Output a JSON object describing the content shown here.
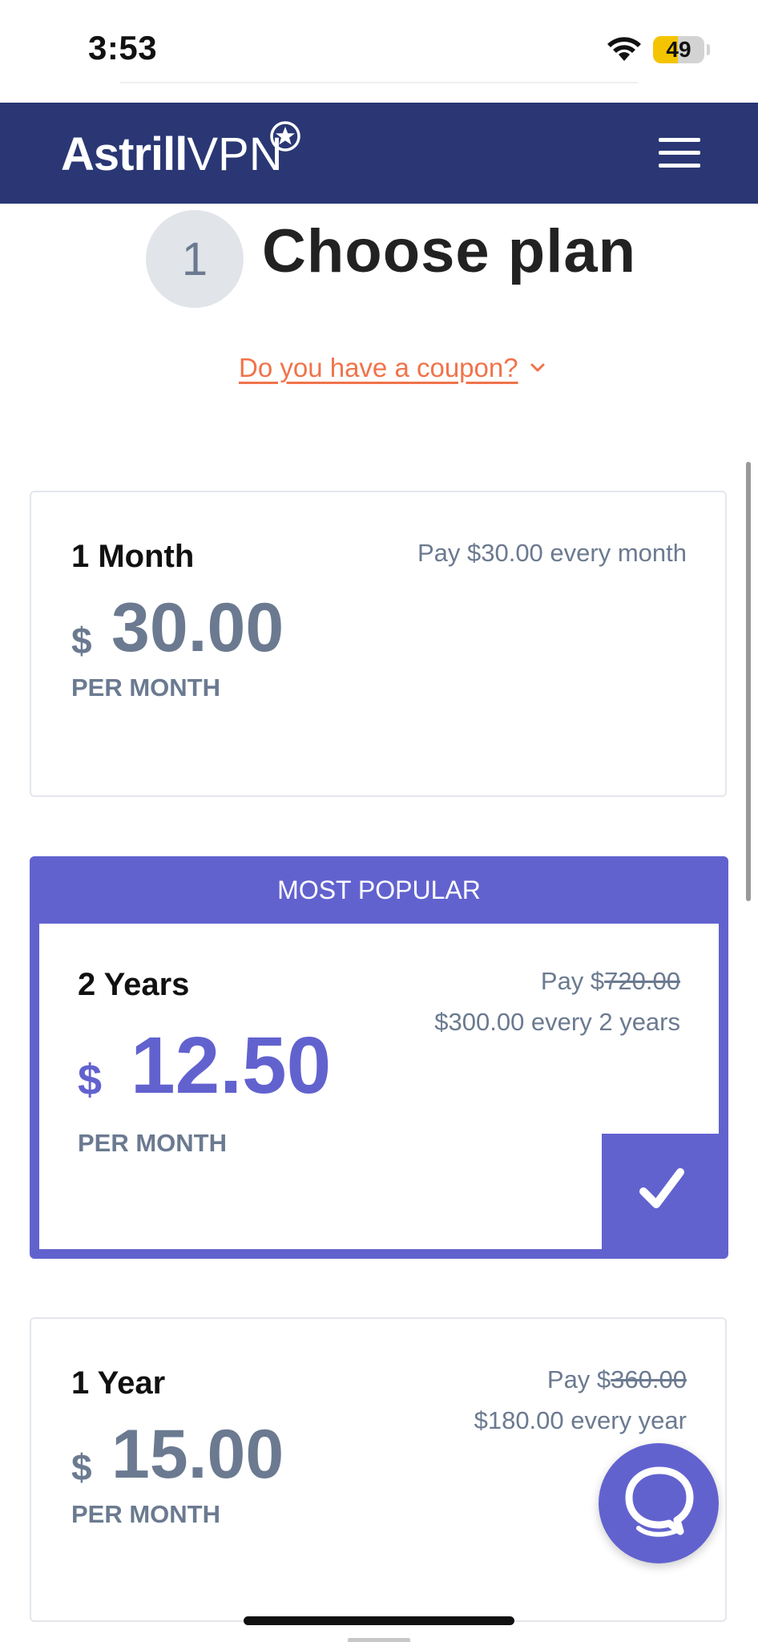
{
  "status_bar": {
    "time": "3:53",
    "battery": "49",
    "battery_level": 0.49
  },
  "header": {
    "logo_bold": "Astrill",
    "logo_light": "VPN"
  },
  "step": {
    "number": "1",
    "title": "Choose plan"
  },
  "coupon": {
    "label": "Do you have a coupon?"
  },
  "plans": [
    {
      "name": "1 Month",
      "currency": "$",
      "price": "30.00",
      "period": "PER MONTH",
      "pay_line": "Pay $30.00 every month"
    },
    {
      "badge": "MOST POPULAR",
      "name": "2 Years",
      "currency": "$",
      "price": "12.50",
      "period": "PER MONTH",
      "pay_prefix": "Pay $",
      "pay_original": "720.00",
      "pay_total": "$300.00 every 2 years",
      "selected": true
    },
    {
      "name": "1 Year",
      "currency": "$",
      "price": "15.00",
      "period": "PER MONTH",
      "pay_prefix": "Pay $",
      "pay_original": "360.00",
      "pay_total": "$180.00 every year"
    }
  ],
  "colors": {
    "navbar": "#2a3774",
    "accent": "#6262cf",
    "coupon": "#f0734a",
    "price_gray": "#6b7a90"
  },
  "icons": [
    "wifi-icon",
    "battery-icon",
    "star-badge-icon",
    "menu-icon",
    "chevron-down-icon",
    "checkmark-icon",
    "chat-bubble-icon"
  ]
}
